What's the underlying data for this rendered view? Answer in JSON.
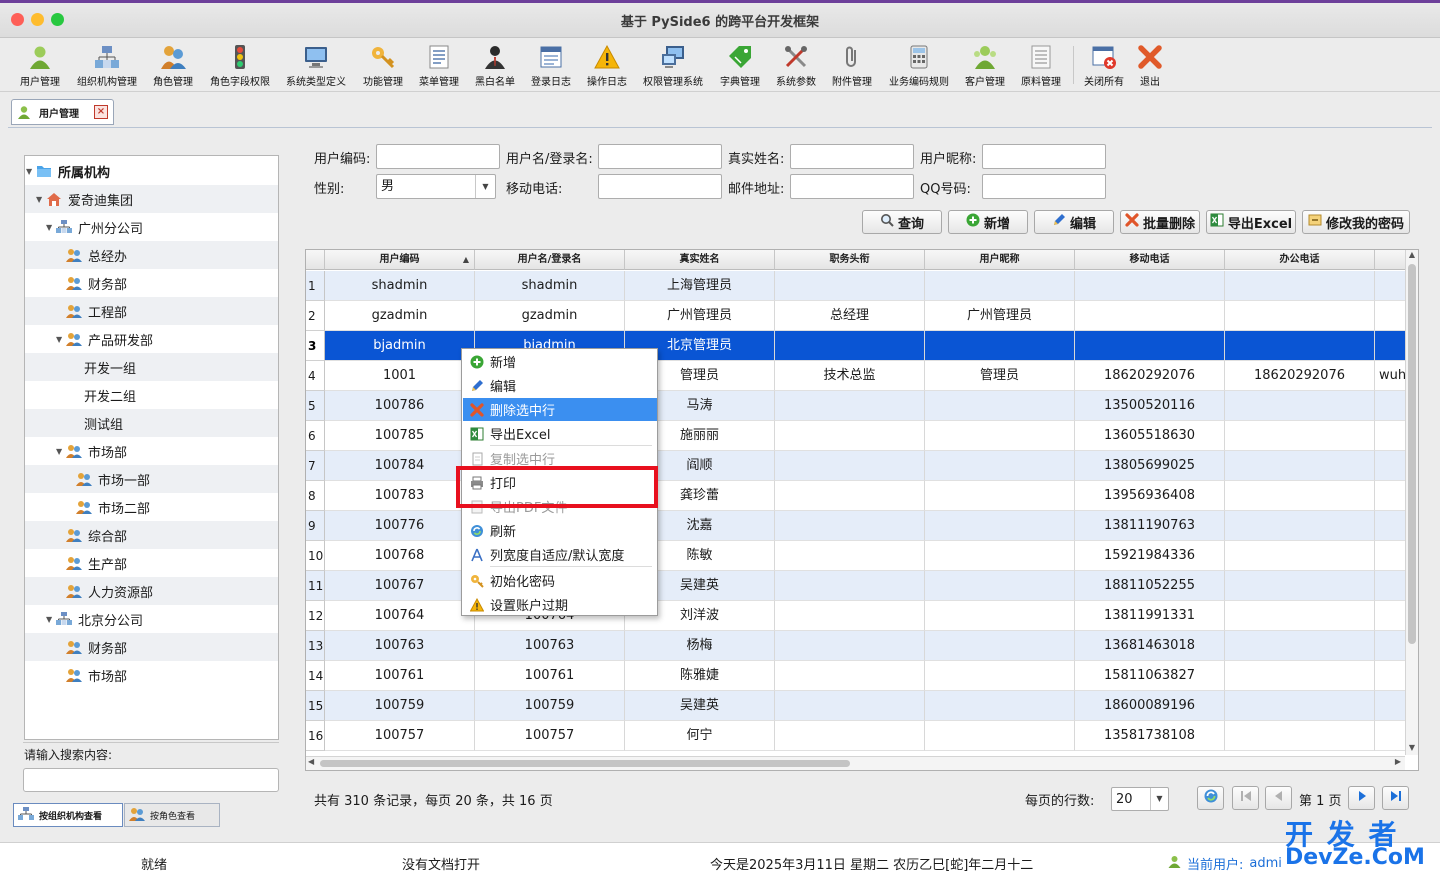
{
  "window": {
    "title": "基于 PySide6 的跨平台开发框架"
  },
  "toolbar": {
    "items": [
      {
        "label": "用户管理",
        "icon": "user-icon"
      },
      {
        "label": "组织机构管理",
        "icon": "org-icon"
      },
      {
        "label": "角色管理",
        "icon": "role-icon"
      },
      {
        "label": "角色字段权限",
        "icon": "traffic-light-icon"
      },
      {
        "label": "系统类型定义",
        "icon": "monitor-icon"
      },
      {
        "label": "功能管理",
        "icon": "key-icon"
      },
      {
        "label": "菜单管理",
        "icon": "menu-doc-icon"
      },
      {
        "label": "黑白名单",
        "icon": "agent-icon"
      },
      {
        "label": "登录日志",
        "icon": "log-icon"
      },
      {
        "label": "操作日志",
        "icon": "warning-icon"
      },
      {
        "label": "权限管理系统",
        "icon": "computers-icon"
      },
      {
        "label": "字典管理",
        "icon": "tag-icon"
      },
      {
        "label": "系统参数",
        "icon": "tools-icon"
      },
      {
        "label": "附件管理",
        "icon": "paperclip-icon"
      },
      {
        "label": "业务编码规则",
        "icon": "calculator-icon"
      },
      {
        "label": "客户管理",
        "icon": "customers-icon"
      },
      {
        "label": "原料管理",
        "icon": "list-icon"
      },
      {
        "label": "关闭所有",
        "icon": "close-all-icon"
      },
      {
        "label": "退出",
        "icon": "exit-icon"
      }
    ]
  },
  "tab": {
    "label": "用户管理",
    "close": "×"
  },
  "tree": {
    "nodes": [
      {
        "label": "所属机构",
        "level": 0,
        "arrow": "▼",
        "type": "folder",
        "bold": true
      },
      {
        "label": "爱奇迪集团",
        "level": 1,
        "arrow": "▼",
        "type": "home"
      },
      {
        "label": "广州分公司",
        "level": 2,
        "arrow": "▼",
        "type": "org"
      },
      {
        "label": "总经办",
        "level": 3,
        "arrow": "",
        "type": "group"
      },
      {
        "label": "财务部",
        "level": 3,
        "arrow": "",
        "type": "group"
      },
      {
        "label": "工程部",
        "level": 3,
        "arrow": "",
        "type": "group"
      },
      {
        "label": "产品研发部",
        "level": 3,
        "arrow": "▼",
        "type": "group"
      },
      {
        "label": "开发一组",
        "level": 4,
        "arrow": "",
        "type": "none"
      },
      {
        "label": "开发二组",
        "level": 4,
        "arrow": "",
        "type": "none"
      },
      {
        "label": "测试组",
        "level": 4,
        "arrow": "",
        "type": "none"
      },
      {
        "label": "市场部",
        "level": 3,
        "arrow": "▼",
        "type": "group"
      },
      {
        "label": "市场一部",
        "level": 4,
        "arrow": "",
        "type": "group"
      },
      {
        "label": "市场二部",
        "level": 4,
        "arrow": "",
        "type": "group"
      },
      {
        "label": "综合部",
        "level": 3,
        "arrow": "",
        "type": "group"
      },
      {
        "label": "生产部",
        "level": 3,
        "arrow": "",
        "type": "group"
      },
      {
        "label": "人力资源部",
        "level": 3,
        "arrow": "",
        "type": "group"
      },
      {
        "label": "北京分公司",
        "level": 2,
        "arrow": "▼",
        "type": "org"
      },
      {
        "label": "财务部",
        "level": 3,
        "arrow": "",
        "type": "group"
      },
      {
        "label": "市场部",
        "level": 3,
        "arrow": "",
        "type": "group"
      }
    ]
  },
  "search": {
    "label": "请输入搜索内容:",
    "value": ""
  },
  "bottom_tabs": [
    {
      "label": "按组织机构查看",
      "active": true
    },
    {
      "label": "按角色查看",
      "active": false
    }
  ],
  "filters": {
    "user_code": {
      "label": "用户编码:",
      "value": ""
    },
    "username": {
      "label": "用户名/登录名:",
      "value": ""
    },
    "real_name": {
      "label": "真实姓名:",
      "value": ""
    },
    "nickname": {
      "label": "用户昵称:",
      "value": ""
    },
    "gender": {
      "label": "性别:",
      "value": "男"
    },
    "mobile": {
      "label": "移动电话:",
      "value": ""
    },
    "email": {
      "label": "邮件地址:",
      "value": ""
    },
    "qq": {
      "label": "QQ号码:",
      "value": ""
    }
  },
  "actions": [
    {
      "label": "查询",
      "icon": "search-icon"
    },
    {
      "label": "新增",
      "icon": "add-icon"
    },
    {
      "label": "编辑",
      "icon": "edit-icon"
    },
    {
      "label": "批量删除",
      "icon": "delete-icon"
    },
    {
      "label": "导出Excel",
      "icon": "excel-icon"
    },
    {
      "label": "修改我的密码",
      "icon": "password-icon"
    }
  ],
  "table": {
    "columns": [
      "用户编码",
      "用户名/登录名",
      "真实姓名",
      "职务头衔",
      "用户昵称",
      "移动电话",
      "办公电话",
      ""
    ],
    "sort_indicator": "▲",
    "selected_row": 3,
    "rows": [
      [
        "1",
        "shadmin",
        "shadmin",
        "上海管理员",
        "",
        "",
        "",
        "",
        ""
      ],
      [
        "2",
        "gzadmin",
        "gzadmin",
        "广州管理员",
        "总经理",
        "广州管理员",
        "",
        "",
        ""
      ],
      [
        "3",
        "bjadmin",
        "bjadmin",
        "北京管理员",
        "",
        "",
        "",
        "",
        ""
      ],
      [
        "4",
        "1001",
        "",
        "管理员",
        "技术总监",
        "管理员",
        "18620292076",
        "18620292076",
        "wuh"
      ],
      [
        "5",
        "100786",
        "",
        "马涛",
        "",
        "",
        "13500520116",
        "",
        ""
      ],
      [
        "6",
        "100785",
        "",
        "施丽丽",
        "",
        "",
        "13605518630",
        "",
        ""
      ],
      [
        "7",
        "100784",
        "",
        "阎顺",
        "",
        "",
        "13805699025",
        "",
        ""
      ],
      [
        "8",
        "100783",
        "",
        "龚珍蕾",
        "",
        "",
        "13956936408",
        "",
        ""
      ],
      [
        "9",
        "100776",
        "",
        "沈嘉",
        "",
        "",
        "13811190763",
        "",
        ""
      ],
      [
        "10",
        "100768",
        "",
        "陈敏",
        "",
        "",
        "15921984336",
        "",
        ""
      ],
      [
        "11",
        "100767",
        "",
        "吴建英",
        "",
        "",
        "18811052255",
        "",
        ""
      ],
      [
        "12",
        "100764",
        "100764",
        "刘洋波",
        "",
        "",
        "13811991331",
        "",
        ""
      ],
      [
        "13",
        "100763",
        "100763",
        "杨梅",
        "",
        "",
        "13681463018",
        "",
        ""
      ],
      [
        "14",
        "100761",
        "100761",
        "陈雅婕",
        "",
        "",
        "15811063827",
        "",
        ""
      ],
      [
        "15",
        "100759",
        "100759",
        "吴建英",
        "",
        "",
        "18600089196",
        "",
        ""
      ],
      [
        "16",
        "100757",
        "100757",
        "何宁",
        "",
        "",
        "13581738108",
        "",
        ""
      ]
    ]
  },
  "context_menu": {
    "items": [
      {
        "label": "新增",
        "icon": "add-icon",
        "highlighted": false
      },
      {
        "label": "编辑",
        "icon": "edit-icon",
        "highlighted": false
      },
      {
        "label": "删除选中行",
        "icon": "delete-icon",
        "highlighted": true
      },
      {
        "label": "导出Excel",
        "icon": "excel-icon",
        "highlighted": false
      },
      {
        "label": "复制选中行",
        "icon": "copy-icon",
        "highlighted": false
      },
      {
        "label": "打印",
        "icon": "printer-icon",
        "highlighted": false
      },
      {
        "label": "导出PDF文件",
        "icon": "pdf-icon",
        "highlighted": false
      },
      {
        "label": "刷新",
        "icon": "refresh-icon",
        "highlighted": false
      },
      {
        "label": "列宽度自适应/默认宽度",
        "icon": "column-width-icon",
        "highlighted": false
      },
      {
        "label": "初始化密码",
        "icon": "init-password-icon",
        "highlighted": false
      },
      {
        "label": "设置账户过期",
        "icon": "expire-warning-icon",
        "highlighted": false
      }
    ]
  },
  "pagination": {
    "summary": "共有 310 条记录，每页 20 条，共 16 页",
    "rows_label": "每页的行数:",
    "rows_value": "20",
    "page_label": "第 1 页"
  },
  "status": {
    "ready": "就绪",
    "doc": "没有文档打开",
    "date": "今天是2025年3月11日 星期二 农历乙巳[蛇]年二月十二",
    "user_label": "当前用户:",
    "user_value": "admi"
  },
  "watermark": {
    "line1": "开 发 者",
    "line2": "DevZe.CoM"
  },
  "colors": {
    "accent": "#0a55d4",
    "menu_highlight": "#3b8ff0",
    "annotation_red": "#e8101e",
    "alt_row": "#e5edf9"
  }
}
